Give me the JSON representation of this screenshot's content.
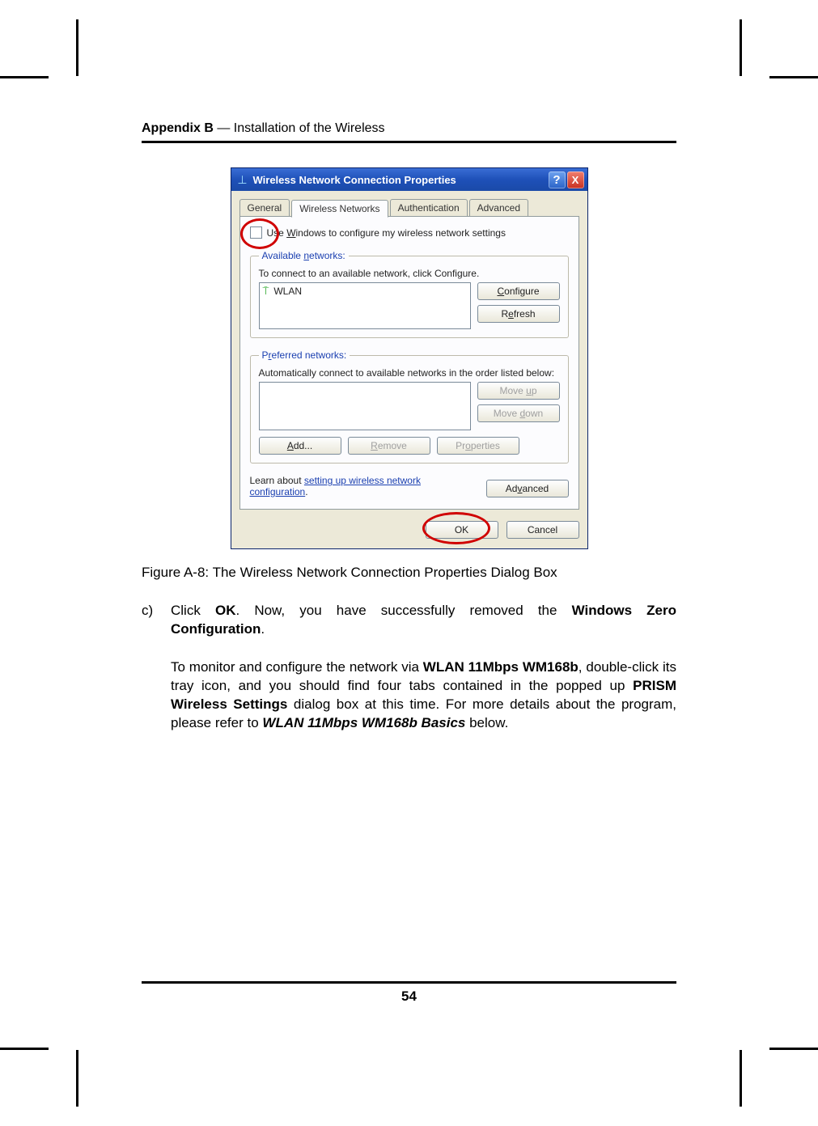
{
  "header": {
    "appendix": "Appendix B",
    "rest": " — Installation of the Wireless"
  },
  "dialog": {
    "title": "Wireless Network Connection Properties",
    "tabs": {
      "general": "General",
      "wireless": "Wireless Networks",
      "auth": "Authentication",
      "advanced": "Advanced"
    },
    "checkbox_pre": "U",
    "checkbox_mid": "se ",
    "checkbox_underline": "W",
    "checkbox_post": "indows to configure my wireless network settings",
    "available": {
      "legend": "Available networks:",
      "legend_underline": "n",
      "instruction": "To connect to an available network, click Configure.",
      "item": "WLAN",
      "configure": "Configure",
      "configure_ul": "C",
      "refresh": "Refresh",
      "refresh_ul_first": "R",
      "refresh_ul_mid": "f"
    },
    "preferred": {
      "legend_pre": "P",
      "legend_ul": "r",
      "legend_post": "eferred networks:",
      "instruction": "Automatically connect to available networks in the order listed below:",
      "moveup": "Move up",
      "moveup_ul": "u",
      "movedown": "Move down",
      "movedown_ul": "d",
      "add": "Add...",
      "add_ul": "A",
      "remove": "Remove",
      "remove_ul": "R",
      "properties": "Properties",
      "properties_ul_first": "Pr",
      "properties_ul": "o",
      "properties_post": "perties"
    },
    "learn_pre": "Learn about ",
    "learn_link": "setting up wireless network configuration",
    "learn_post": ".",
    "advanced_btn": "Advanced",
    "advanced_ul": "v",
    "ok": "OK",
    "cancel": "Cancel"
  },
  "caption": "Figure A-8: The Wireless Network Connection Properties Dialog Box",
  "step": {
    "marker": "c)",
    "t1": "Click ",
    "b1": "OK",
    "t2": ". Now, you have successfully removed the ",
    "b2": "Windows Zero Configuration",
    "t3": "."
  },
  "para": {
    "t1": "To monitor and configure the network via ",
    "b1": "WLAN 11Mbps WM168b",
    "t2": ", double-click its tray icon, and you should find four tabs contained in the popped up ",
    "b2": "PRISM Wireless Settings",
    "t3": " dialog box at this time. For more details about the program, please refer to ",
    "ib": "WLAN 11Mbps WM168b Basics",
    "t4": " below."
  },
  "page_number": "54"
}
